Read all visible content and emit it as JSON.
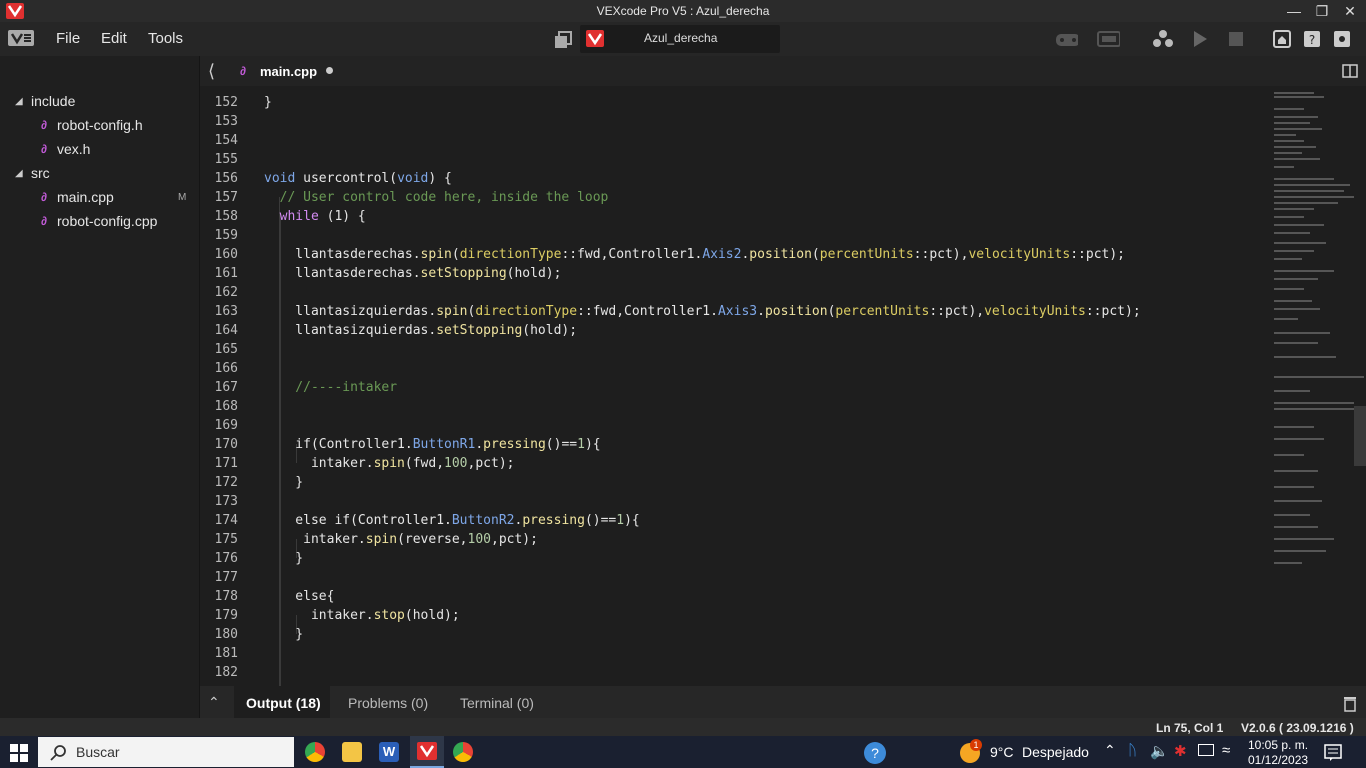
{
  "window": {
    "title": "VEXcode Pro V5 : Azul_derecha"
  },
  "menu": {
    "file": "File",
    "edit": "Edit",
    "tools": "Tools"
  },
  "project": {
    "name": "Azul_derecha"
  },
  "sidebar": {
    "folders": [
      {
        "label": "include",
        "files": [
          "robot-config.h",
          "vex.h"
        ]
      },
      {
        "label": "src",
        "files": [
          "main.cpp",
          "robot-config.cpp"
        ]
      }
    ],
    "modified_badge": "M"
  },
  "tab": {
    "label": "main.cpp"
  },
  "code": {
    "l152": {
      "n": "152",
      "t": "}"
    },
    "l153": {
      "n": "153"
    },
    "l154": {
      "n": "154"
    },
    "l155": {
      "n": "155"
    },
    "l156": {
      "n": "156",
      "a": "void",
      "b": " usercontrol(",
      "c": "void",
      "d": ") {"
    },
    "l157": {
      "n": "157",
      "t": "  // User control code here, inside the loop"
    },
    "l158": {
      "n": "158",
      "a": "  while",
      "b": " (1) {"
    },
    "l159": {
      "n": "159"
    },
    "l160": {
      "n": "160",
      "p1": "    llantasderechas.",
      "p2": "spin",
      "p3": "(",
      "p4": "directionType",
      "p5": "::fwd,Controller1.",
      "p6": "Axis2",
      "p7": ".",
      "p8": "position",
      "p9": "(",
      "p10": "percentUnits",
      "p11": "::pct),",
      "p12": "velocityUnits",
      "p13": "::pct);"
    },
    "l161": {
      "n": "161",
      "p1": "    llantasderechas.",
      "p2": "setStopping",
      "p3": "(hold);"
    },
    "l162": {
      "n": "162"
    },
    "l163": {
      "n": "163",
      "p1": "    llantasizquierdas.",
      "p2": "spin",
      "p3": "(",
      "p4": "directionType",
      "p5": "::fwd,Controller1.",
      "p6": "Axis3",
      "p7": ".",
      "p8": "position",
      "p9": "(",
      "p10": "percentUnits",
      "p11": "::pct),",
      "p12": "velocityUnits",
      "p13": "::pct);"
    },
    "l164": {
      "n": "164",
      "p1": "    llantasizquierdas.",
      "p2": "setStopping",
      "p3": "(hold);"
    },
    "l165": {
      "n": "165"
    },
    "l166": {
      "n": "166"
    },
    "l167": {
      "n": "167",
      "t": "    //----intaker"
    },
    "l168": {
      "n": "168"
    },
    "l169": {
      "n": "169"
    },
    "l170": {
      "n": "170",
      "p1": "    if(Controller1.",
      "p2": "ButtonR1",
      "p3": ".",
      "p4": "pressing",
      "p5": "()==",
      "p6": "1",
      "p7": "){"
    },
    "l171": {
      "n": "171",
      "p1": "      intaker.",
      "p2": "spin",
      "p3": "(fwd,",
      "p4": "100",
      "p5": ",pct);"
    },
    "l172": {
      "n": "172",
      "t": "    }"
    },
    "l173": {
      "n": "173"
    },
    "l174": {
      "n": "174",
      "p0": "    else ",
      "p1": "if(Controller1.",
      "p2": "ButtonR2",
      "p3": ".",
      "p4": "pressing",
      "p5": "()==",
      "p6": "1",
      "p7": "){"
    },
    "l175": {
      "n": "175",
      "p1": "     intaker.",
      "p2": "spin",
      "p3": "(reverse,",
      "p4": "100",
      "p5": ",pct);"
    },
    "l176": {
      "n": "176",
      "t": "    }"
    },
    "l177": {
      "n": "177"
    },
    "l178": {
      "n": "178",
      "t": "    else{"
    },
    "l179": {
      "n": "179",
      "p1": "      intaker.",
      "p2": "stop",
      "p3": "(hold);"
    },
    "l180": {
      "n": "180",
      "t": "    }"
    },
    "l181": {
      "n": "181"
    },
    "l182": {
      "n": "182"
    }
  },
  "panel": {
    "output": "Output (18)",
    "problems": "Problems (0)",
    "terminal": "Terminal (0)"
  },
  "status": {
    "position": "Ln 75, Col 1",
    "version": "V2.0.6 ( 23.09.1216 )"
  },
  "taskbar": {
    "search_placeholder": "Buscar",
    "weather_temp": "9°C",
    "weather_desc": "Despejado",
    "weather_badge": "1",
    "time": "10:05 p. m.",
    "date": "01/12/2023"
  },
  "colors": {
    "accent": "#e03030",
    "keyword": "#d38bf2",
    "type": "#7ea7e8",
    "comment": "#6a9955"
  }
}
